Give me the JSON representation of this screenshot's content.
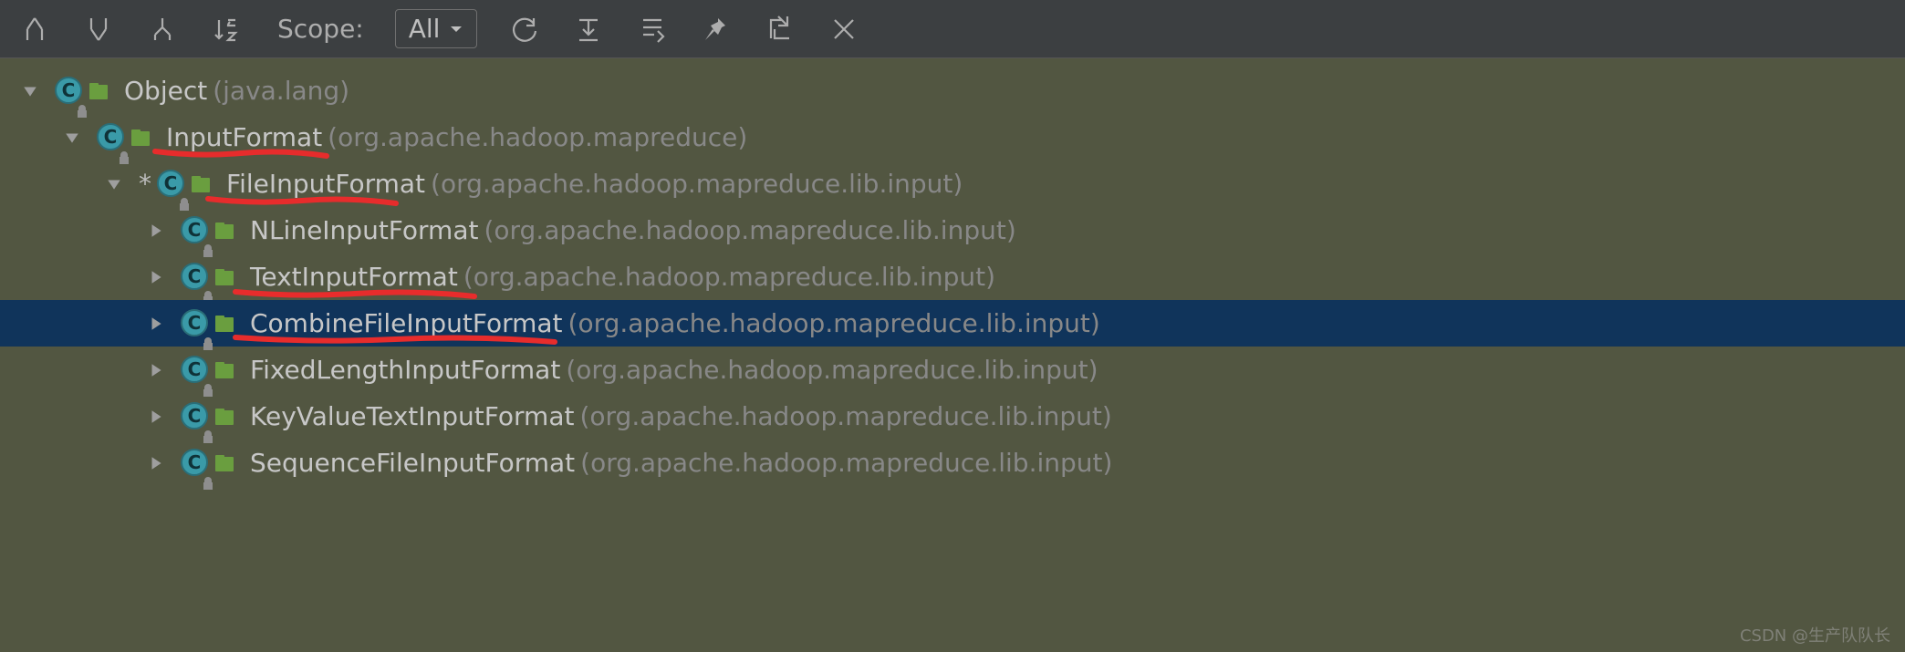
{
  "toolbar": {
    "scope_label": "Scope:",
    "scope_value": "All"
  },
  "tree": [
    {
      "indent": 0,
      "arrow": "down",
      "asterisk": false,
      "name": "Object",
      "pkg": "(java.lang)",
      "selected": false
    },
    {
      "indent": 1,
      "arrow": "down",
      "asterisk": false,
      "name": "InputFormat",
      "pkg": "(org.apache.hadoop.mapreduce)",
      "selected": false,
      "underline": true,
      "ux": 170,
      "uy": 166,
      "uw": 188
    },
    {
      "indent": 2,
      "arrow": "down",
      "asterisk": true,
      "name": "FileInputFormat",
      "pkg": "(org.apache.hadoop.mapreduce.lib.input)",
      "selected": false,
      "underline": true,
      "ux": 228,
      "uy": 218,
      "uw": 206
    },
    {
      "indent": 3,
      "arrow": "right",
      "asterisk": false,
      "name": "NLineInputFormat",
      "pkg": "(org.apache.hadoop.mapreduce.lib.input)",
      "selected": false
    },
    {
      "indent": 3,
      "arrow": "right",
      "asterisk": false,
      "name": "TextInputFormat",
      "pkg": "(org.apache.hadoop.mapreduce.lib.input)",
      "selected": false,
      "underline": true,
      "ux": 258,
      "uy": 320,
      "uw": 262
    },
    {
      "indent": 3,
      "arrow": "right",
      "asterisk": false,
      "name": "CombineFileInputFormat",
      "pkg": "(org.apache.hadoop.mapreduce.lib.input)",
      "selected": true,
      "underline": true,
      "ux": 258,
      "uy": 370,
      "uw": 350
    },
    {
      "indent": 3,
      "arrow": "right",
      "asterisk": false,
      "name": "FixedLengthInputFormat",
      "pkg": "(org.apache.hadoop.mapreduce.lib.input)",
      "selected": false
    },
    {
      "indent": 3,
      "arrow": "right",
      "asterisk": false,
      "name": "KeyValueTextInputFormat",
      "pkg": "(org.apache.hadoop.mapreduce.lib.input)",
      "selected": false
    },
    {
      "indent": 3,
      "arrow": "right",
      "asterisk": false,
      "name": "SequenceFileInputFormat",
      "pkg": "(org.apache.hadoop.mapreduce.lib.input)",
      "selected": false
    }
  ],
  "watermark": "CSDN @生产队队长"
}
